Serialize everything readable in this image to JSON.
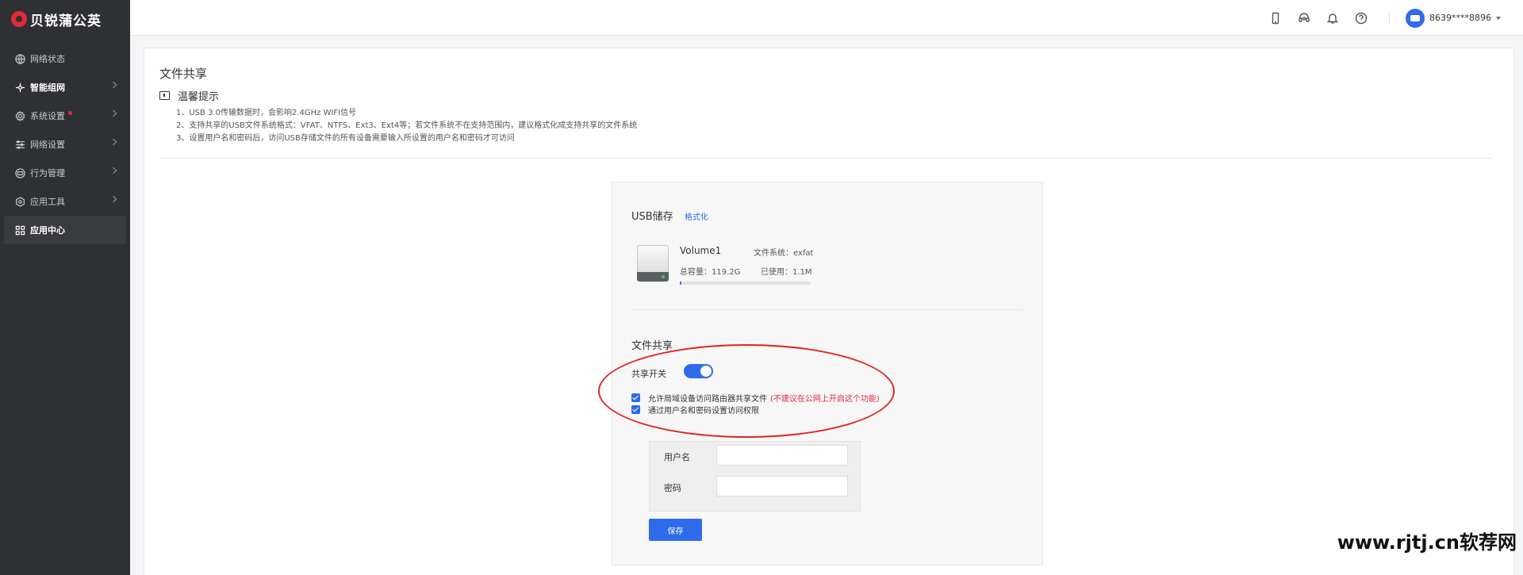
{
  "app": {
    "brand": "贝锐蒲公英"
  },
  "sidebar": {
    "items": [
      {
        "label": "网络状态",
        "icon": "globe-icon"
      },
      {
        "label": "智能组网",
        "icon": "network-icon"
      },
      {
        "label": "系统设置",
        "icon": "gear-icon"
      },
      {
        "label": "网络设置",
        "icon": "sliders-icon"
      },
      {
        "label": "行为管理",
        "icon": "behavior-icon"
      },
      {
        "label": "应用工具",
        "icon": "hexagon-icon"
      },
      {
        "label": "应用中心",
        "icon": "grid-icon"
      }
    ]
  },
  "header": {
    "icons": [
      "mobile-icon",
      "support-icon",
      "bell-icon",
      "help-icon"
    ],
    "user": "8639****8896"
  },
  "page": {
    "title": "文件共享",
    "tips_title": "温馨提示",
    "tips": [
      "1、USB 3.0传输数据时，会影响2.4GHz WIFI信号",
      "2、支持共享的USB文件系统格式：VFAT、NTFS、Ext3、Ext4等；若文件系统不在支持范围内，建议格式化成支持共享的文件系统",
      "3、设置用户名和密码后，访问USB存储文件的所有设备需要输入所设置的用户名和密码才可访问"
    ]
  },
  "usb": {
    "title": "USB储存",
    "format_link": "格式化",
    "volume": "Volume1",
    "fs": "文件系统：exfat",
    "total": "总容量：119.2G",
    "used": "已使用：1.1M",
    "used_fraction": 0.0001
  },
  "share": {
    "title": "文件共享",
    "switch_label": "共享开关",
    "switch_on": true,
    "allow_lan": "允许局域设备访问路由器共享文件",
    "warning": "(不建议在公网上开启这个功能)",
    "auth": "通过用户名和密码设置访问权限",
    "username_label": "用户名",
    "password_label": "密码",
    "username_value": "",
    "password_value": "",
    "save": "保存"
  },
  "watermark": "www.rjtj.cn软荐网",
  "colors": {
    "accent": "#2e6bea",
    "sidebar": "#2f3033",
    "danger": "#e5293a"
  }
}
